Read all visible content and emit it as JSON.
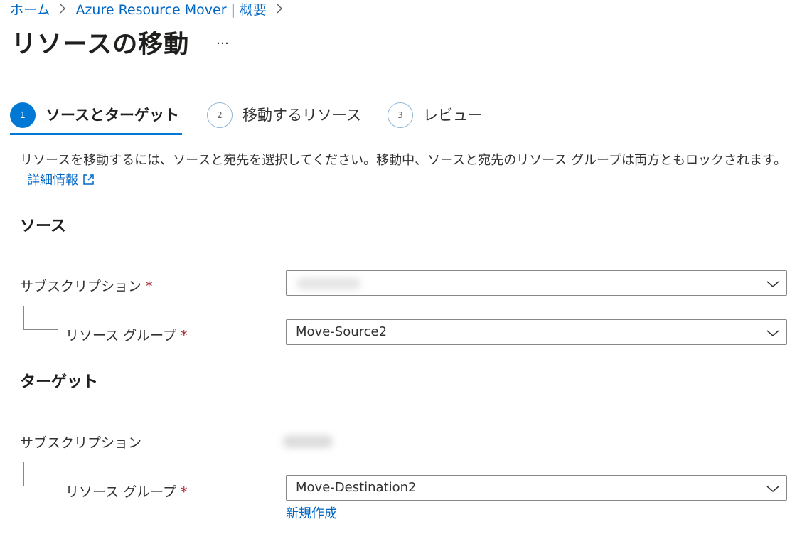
{
  "breadcrumb": {
    "home": "ホーム",
    "parent": "Azure Resource Mover | 概要"
  },
  "page": {
    "title": "リソースの移動",
    "more": "…"
  },
  "steps": [
    {
      "number": "1",
      "label": "ソースとターゲット",
      "state": "active"
    },
    {
      "number": "2",
      "label": "移動するリソース",
      "state": "inactive"
    },
    {
      "number": "3",
      "label": "レビュー",
      "state": "inactive"
    }
  ],
  "description": {
    "text": "リソースを移動するには、ソースと宛先を選択してください。移動中、ソースと宛先のリソース グループは両方ともロックされます。",
    "link": "詳細情報"
  },
  "source": {
    "title": "ソース",
    "subscription_label": "サブスクリプション",
    "resource_group_label": "リソース グループ",
    "resource_group_value": "Move-Source2"
  },
  "target": {
    "title": "ターゲット",
    "subscription_label": "サブスクリプション",
    "resource_group_label": "リソース グループ",
    "resource_group_value": "Move-Destination2",
    "create_new": "新規作成"
  },
  "required_marker": "*",
  "icons": {
    "breadcrumb_separator": "chevron-right-icon",
    "dropdown": "chevron-down-icon",
    "external_link": "external-link-icon"
  },
  "colors": {
    "accent": "#0078d4",
    "link": "#0066c4",
    "required": "#a4262c"
  }
}
